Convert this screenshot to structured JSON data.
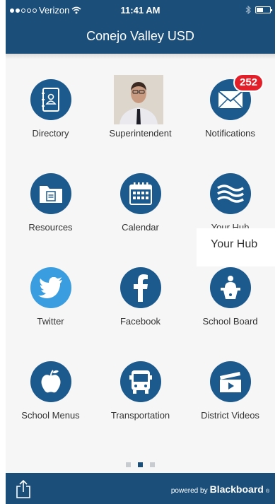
{
  "status_bar": {
    "carrier": "Verizon",
    "time": "11:41 AM"
  },
  "header": {
    "title": "Conejo Valley USD"
  },
  "tiles": [
    {
      "label": "Directory",
      "icon": "address-book-icon"
    },
    {
      "label": "Superintendent",
      "icon": "superintendent-photo"
    },
    {
      "label": "Notifications",
      "icon": "envelope-icon",
      "badge": "252"
    },
    {
      "label": "Resources",
      "icon": "folder-icon"
    },
    {
      "label": "Calendar",
      "icon": "calendar-icon"
    },
    {
      "label": "Your Hub",
      "icon": "waves-icon"
    },
    {
      "label": "Twitter",
      "icon": "twitter-bird-icon"
    },
    {
      "label": "Facebook",
      "icon": "facebook-f-icon"
    },
    {
      "label": "School Board",
      "icon": "podium-speaker-icon"
    },
    {
      "label": "School Menus",
      "icon": "apple-icon"
    },
    {
      "label": "Transportation",
      "icon": "bus-icon"
    },
    {
      "label": "District Videos",
      "icon": "clapperboard-icon"
    }
  ],
  "tooltip": {
    "text": "Your Hub"
  },
  "pager": {
    "pages": 3,
    "current": 2
  },
  "footer": {
    "powered_by": "powered by",
    "brand": "Blackboard",
    "brand_mark": "®"
  },
  "colors": {
    "header": "#1b4f7a",
    "icon_circle": "#1c5a8e",
    "twitter_circle": "#3a9de0",
    "badge": "#e3202a"
  }
}
